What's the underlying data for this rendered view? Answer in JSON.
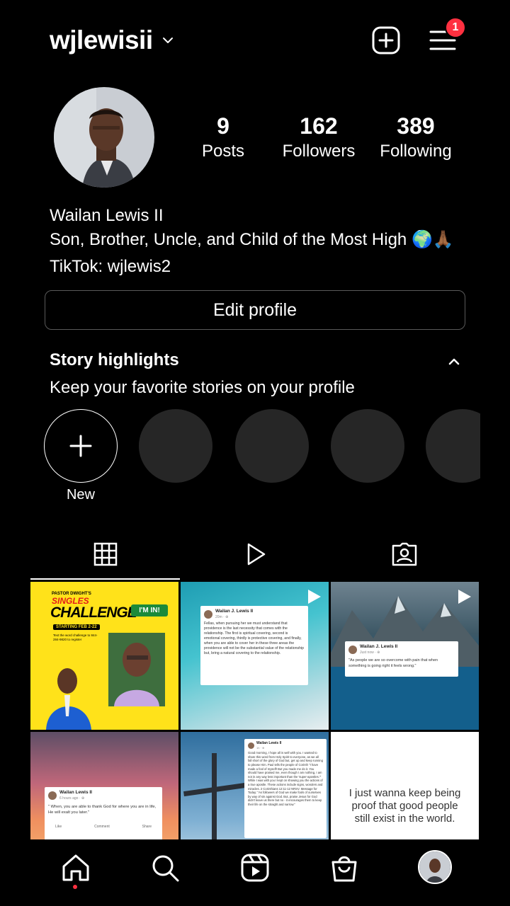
{
  "header": {
    "username": "wjlewisii",
    "notification_count": "1"
  },
  "profile": {
    "stats": [
      {
        "value": "9",
        "label": "Posts"
      },
      {
        "value": "162",
        "label": "Followers"
      },
      {
        "value": "389",
        "label": "Following"
      }
    ],
    "name": "Wailan Lewis II",
    "bio": "Son, Brother, Uncle, and Child of the Most High 🌍🙏🏾",
    "link_line": "TikTok: wjlewis2",
    "edit_button": "Edit profile"
  },
  "highlights": {
    "title": "Story highlights",
    "subtitle": "Keep your favorite stories on your profile",
    "new_label": "New"
  },
  "posts": {
    "p1": {
      "kicker": "PASTOR DWIGHT'S",
      "title1": "SINGLES",
      "title2": "CHALLENGE",
      "im_in": "I'M IN!",
      "dates": "STARTING FEB 2-22",
      "text": "Text the word challenge to 844-284-9820 to register"
    },
    "p2": {
      "author": "Wailan J. Lewis II",
      "meta": "20m · ⊕",
      "text": "Fellas, when pursuing her we must understand that providence is the last necessity that comes with the relationship. The first is spiritual covering, second is emotional covering, thirdly is protective covering, and finally, when you are able to cover her in these three areas the providence will not be the substantial value of the relationship but, bring a natural covering to the relationship."
    },
    "p3": {
      "author": "Wailan J. Lewis II",
      "meta": "Just now · ⊕",
      "text": "\"As people we are so overcome with pain that when something is going right it feels wrong.\""
    },
    "p4": {
      "author": "Wailan Lewis II",
      "meta": "6 hours ago · ⊕",
      "text": "\" When, you are able to thank God for where you are in life, He will exalt you later.\"",
      "like": "Like",
      "comment": "Comment",
      "share": "Share"
    },
    "p5": {
      "author": "Wailan Lewis II",
      "meta": "1h · ⊕",
      "text": "Good morning, I hope all is well with you. I wanted to share this word from Holy Spirit to everyone, as we all fall short of the glory of God but, get up and keep running to please Him. Paul tells the people of Corinth \"I have made a fool of myself! But you made me do it. You should have praised me, even though I am nothing, I am not in any way less important than the 'super-apostles.'\" While I was with you I kept on showing you the actions of a true apostle. These actions include signs, wonders and miracles. 2 Corinthians 12:11-12 NRSV. Message for Today: \"As followers of God we make fools of ourselves by way of sin against God. But, praise Jesus for God didn't leave us there but no - it encourages them to keep their life on the straight and narrow.\""
    },
    "p6": {
      "text": "I just wanna keep being proof that good people still exist in the world."
    }
  },
  "colors": {
    "background": "#000000",
    "badge": "#ff3040",
    "highlight_placeholder": "#262626",
    "button_border": "#5a5a5a"
  },
  "icons": {
    "create": "plus-square-icon",
    "menu": "hamburger-menu-icon",
    "grid_tab": "grid-icon",
    "reels_tab": "play-icon",
    "tagged_tab": "person-tag-icon",
    "home": "home-icon",
    "search": "search-icon",
    "reels": "reels-icon",
    "shop": "shopping-bag-icon"
  }
}
